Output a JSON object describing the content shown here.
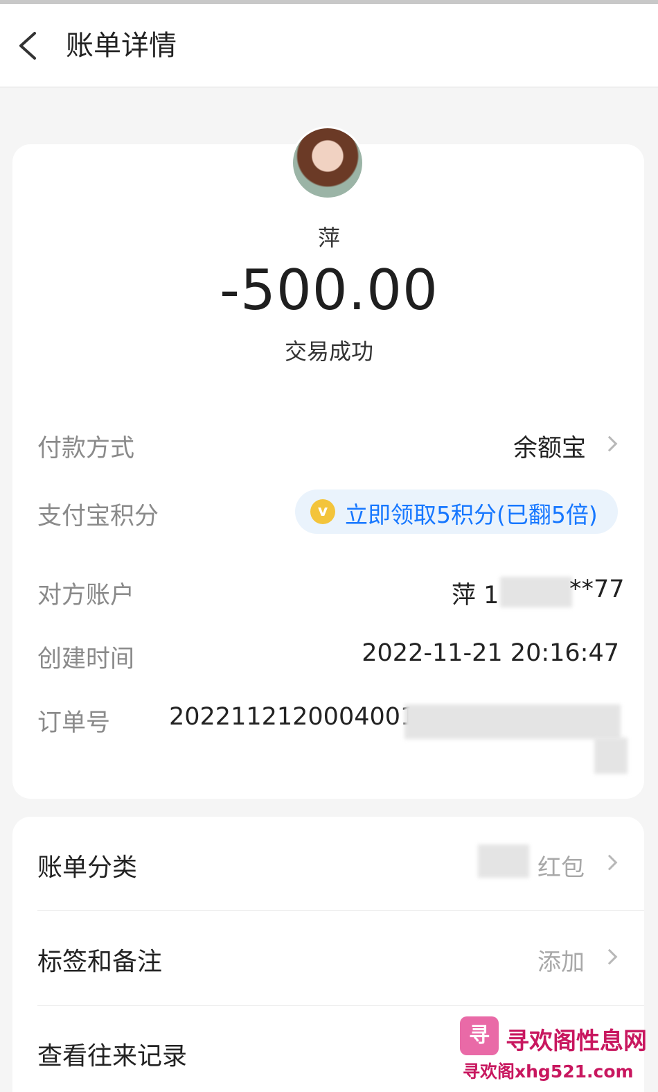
{
  "nav": {
    "title": "账单详情"
  },
  "transaction": {
    "payee": "萍",
    "amount": "-500.00",
    "status": "交易成功"
  },
  "details": {
    "payment_method": {
      "label": "付款方式",
      "value": "余额宝"
    },
    "points": {
      "label": "支付宝积分",
      "badge": "立即领取5积分(已翻5倍)",
      "icon_text": "v"
    },
    "account": {
      "label": "对方账户",
      "value_prefix": "萍 1",
      "value_suffix": "**77"
    },
    "created": {
      "label": "创建时间",
      "value": "2022-11-21 20:16:47"
    },
    "order": {
      "label": "订单号",
      "value": "202211212000400​1"
    }
  },
  "actions": {
    "category": {
      "label": "账单分类",
      "value": "红包"
    },
    "tags": {
      "label": "标签和备注",
      "value": "添加"
    },
    "history": {
      "label": "查看往来记录"
    }
  },
  "watermark": {
    "logo_text": "寻",
    "title": "寻欢阁性息网",
    "url": "寻欢阁xhg521.com"
  },
  "colors": {
    "accent": "#1677ff",
    "pill_bg": "#eaf3fc",
    "coin": "#f3c43b"
  }
}
